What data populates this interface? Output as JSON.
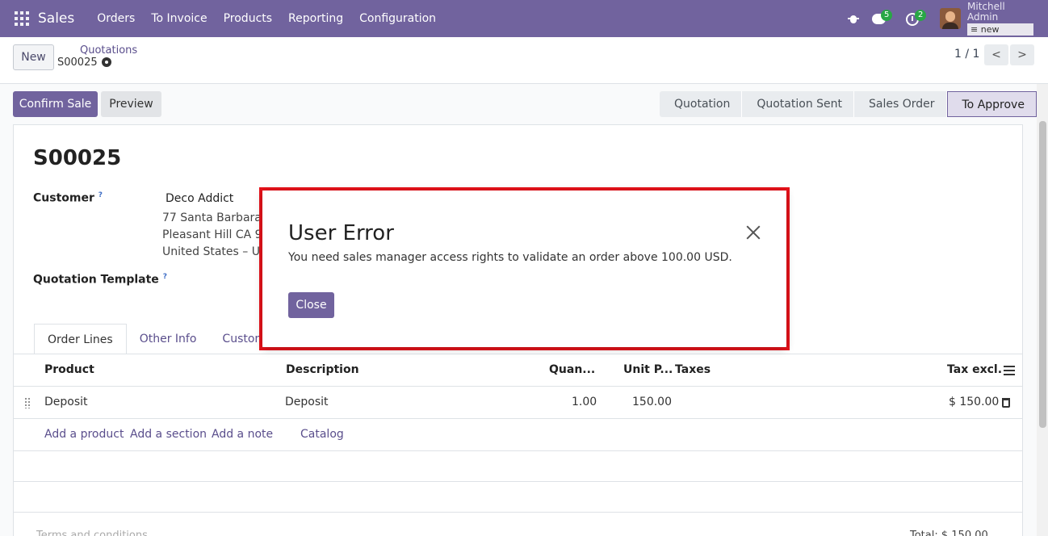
{
  "navbar": {
    "app_name": "Sales",
    "menu": [
      "Orders",
      "To Invoice",
      "Products",
      "Reporting",
      "Configuration"
    ],
    "messages_count": "5",
    "activities_count": "2",
    "user_name": "Mitchell Admin",
    "db_name": "new",
    "accent": "#71639e"
  },
  "control_panel": {
    "new_label": "New",
    "breadcrumb": "Quotations",
    "record": "S00025",
    "pager": "1 / 1",
    "prev": "<",
    "next": ">"
  },
  "status_bar": {
    "confirm_label": "Confirm Sale",
    "preview_label": "Preview",
    "stages": [
      "Quotation",
      "Quotation Sent",
      "Sales Order",
      "To Approve"
    ],
    "active_stage": "To Approve"
  },
  "form": {
    "title": "S00025",
    "customer_label": "Customer",
    "customer_name": "Deco Addict",
    "address": [
      "77 Santa Barbara R",
      "Pleasant Hill CA 94",
      "United States – US"
    ],
    "template_label": "Quotation Template",
    "help": "?",
    "tabs": [
      "Order Lines",
      "Other Info",
      "Custome"
    ],
    "columns": {
      "product": "Product",
      "description": "Description",
      "quantity": "Quan...",
      "unit_price": "Unit P...",
      "taxes": "Taxes",
      "tax_excl": "Tax excl."
    },
    "lines": [
      {
        "product": "Deposit",
        "description": "Deposit",
        "quantity": "1.00",
        "unit_price": "150.00",
        "subtotal": "$ 150.00"
      }
    ],
    "add_links": [
      "Add a product",
      "Add a section",
      "Add a note",
      "Catalog"
    ],
    "terms_placeholder": "Terms and conditions...",
    "total": "Total: $ 150.00"
  },
  "dialog": {
    "title": "User Error",
    "message": "You need sales manager access rights to validate an order above 100.00 USD.",
    "close_label": "Close"
  }
}
